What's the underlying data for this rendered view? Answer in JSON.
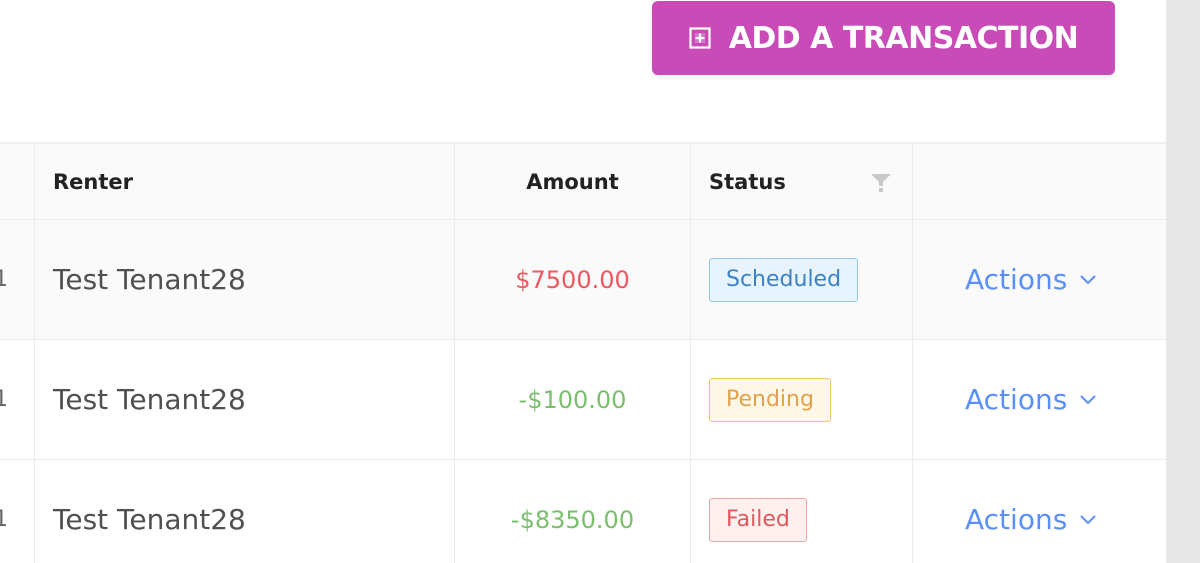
{
  "toolbar": {
    "add_button_label": "ADD A TRANSACTION",
    "add_button_color": "#c84bb8"
  },
  "table": {
    "columns": {
      "renter": "Renter",
      "amount": "Amount",
      "status": "Status"
    },
    "rows": [
      {
        "edge": "1",
        "renter": "Test Tenant28",
        "amount": "$7500.00",
        "amount_color": "#f0575f",
        "status": "Scheduled",
        "status_color": "#3b82c4",
        "status_bg": "#e8f4fd",
        "status_border": "#8fc8f2",
        "action": "Actions"
      },
      {
        "edge": "1",
        "renter": "Test Tenant28",
        "amount": "-$100.00",
        "amount_color": "#7bbf6e",
        "status": "Pending",
        "status_color": "#e0a24b",
        "status_bg": "#fff8e8",
        "status_border": "#f6c56b",
        "action": "Actions"
      },
      {
        "edge": "1",
        "renter": "Test Tenant28",
        "amount": "-$8350.00",
        "amount_color": "#7bbf6e",
        "status": "Failed",
        "status_color": "#e0585c",
        "status_bg": "#fff0f0",
        "status_border": "#f2a5a5",
        "action": "Actions"
      }
    ]
  },
  "icons": {
    "add": "plus-square-icon",
    "filter": "filter-icon",
    "chevron": "chevron-down-icon"
  }
}
